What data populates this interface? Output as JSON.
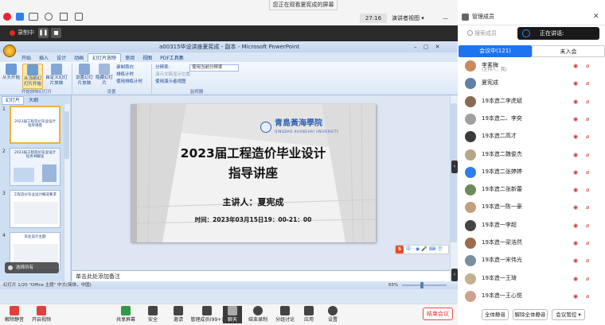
{
  "top": {
    "viewing_banner": "您正在观看夏宪成的屏幕",
    "timer": "27:16",
    "view_mode": "演讲者视图",
    "recording_label": "录制中"
  },
  "ppt": {
    "window_title": "a00315毕设讲座夏宪成 - 副本 - Microsoft PowerPoint",
    "tabs": [
      "开始",
      "插入",
      "设计",
      "动画",
      "幻灯片放映",
      "审阅",
      "视图",
      "PDF工具集"
    ],
    "active_tab": "幻灯片放映",
    "ribbon": {
      "btn_from_start": "从头开始",
      "btn_from_current": "从当前幻灯片开始",
      "btn_custom": "自定义幻灯片放映",
      "btn_setup": "设置幻灯片放映",
      "btn_hide": "隐藏幻灯片",
      "record_narration": "录制旁白",
      "rehearse": "排练计时",
      "use_timings": "使用排练计时",
      "resolution_label": "分辨率:",
      "resolution_value": "使用当前分辨率",
      "show_on": "演示文稿显示位置:",
      "presenter_view": "使用演示者视图",
      "group1": "开始放映幻灯片",
      "group2": "设置",
      "group3": "监视器"
    },
    "left_tabs": [
      "幻灯片",
      "大纲"
    ],
    "thumbnails": [
      {
        "num": "1",
        "title": "2023届工程造价毕业设计指导讲座"
      },
      {
        "num": "2",
        "title": "2023届工程造价毕业设计任务书解读"
      },
      {
        "num": "3",
        "title": "工程造价毕业设计概况要求"
      },
      {
        "num": "4",
        "title": "毕业设计主题"
      }
    ],
    "thumb_toast": "选择所有",
    "slide": {
      "logo_cn": "青島黃海學院",
      "logo_en": "QINGDAO HUANGHAI UNIVERSITY",
      "title_line1": "2023届工程造价毕业设计",
      "title_line2": "指导讲座",
      "speaker": "主讲人：夏宪成",
      "time": "时间：2023年03月15日19：00-21：00"
    },
    "ime_logo": "S",
    "ime_toolbar": "中·◉🎤⌨👕",
    "notes_placeholder": "单击此处添加备注",
    "status_left": "幻灯片 1/20   \"Office 主题\"   中文(简体，中国)",
    "zoom": "65%"
  },
  "bottom": {
    "mute": "解除静音",
    "video": "开启视频",
    "share": "共享屏幕",
    "security": "安全",
    "invite": "邀请",
    "manage": "管理成员(99+)",
    "chat": "聊天",
    "end_record": "结束录制",
    "breakout": "分组讨论",
    "apps": "应用",
    "settings": "设置",
    "end_meeting": "结束会议"
  },
  "panel": {
    "title": "管理成员",
    "search_placeholder": "搜索成员",
    "speaking_label": "正在讲话:",
    "tab_in_meeting": "会议中(121)",
    "tab_not_joined": "未入会",
    "participants": [
      {
        "name": "李素梅",
        "sub": "(主持人，我)",
        "color": "#c98a5c"
      },
      {
        "name": "夏宪成",
        "sub": "",
        "color": "#5d7fa8"
      },
      {
        "name": "19本造二李虎斌",
        "sub": "",
        "color": "#8a6a55"
      },
      {
        "name": "19本造二、李奕",
        "sub": "",
        "color": "#a0a0a0"
      },
      {
        "name": "19本造二高才",
        "sub": "",
        "color": "#3a3a3a"
      },
      {
        "name": "19本造二魏俊杰",
        "sub": "",
        "color": "#b8a48a"
      },
      {
        "name": "19本造二张婷婷",
        "sub": "",
        "color": "#2d7ff0"
      },
      {
        "name": "19本造二张新蕾",
        "sub": "",
        "color": "#6e8a5a"
      },
      {
        "name": "19本造一陈一豪",
        "sub": "",
        "color": "#c2a07a"
      },
      {
        "name": "19本造一李超",
        "sub": "",
        "color": "#444444"
      },
      {
        "name": "19本造一梁浩然",
        "sub": "",
        "color": "#9a6c4e"
      },
      {
        "name": "19本造一宋伟光",
        "sub": "",
        "color": "#7a8fa0"
      },
      {
        "name": "19本造一王琦",
        "sub": "",
        "color": "#c4b090"
      },
      {
        "name": "19本造一王心悦",
        "sub": "",
        "color": "#d0a090"
      }
    ],
    "btn_mute_all": "全体静音",
    "btn_unmute_all": "解除全体静音",
    "btn_control": "会议管控"
  }
}
